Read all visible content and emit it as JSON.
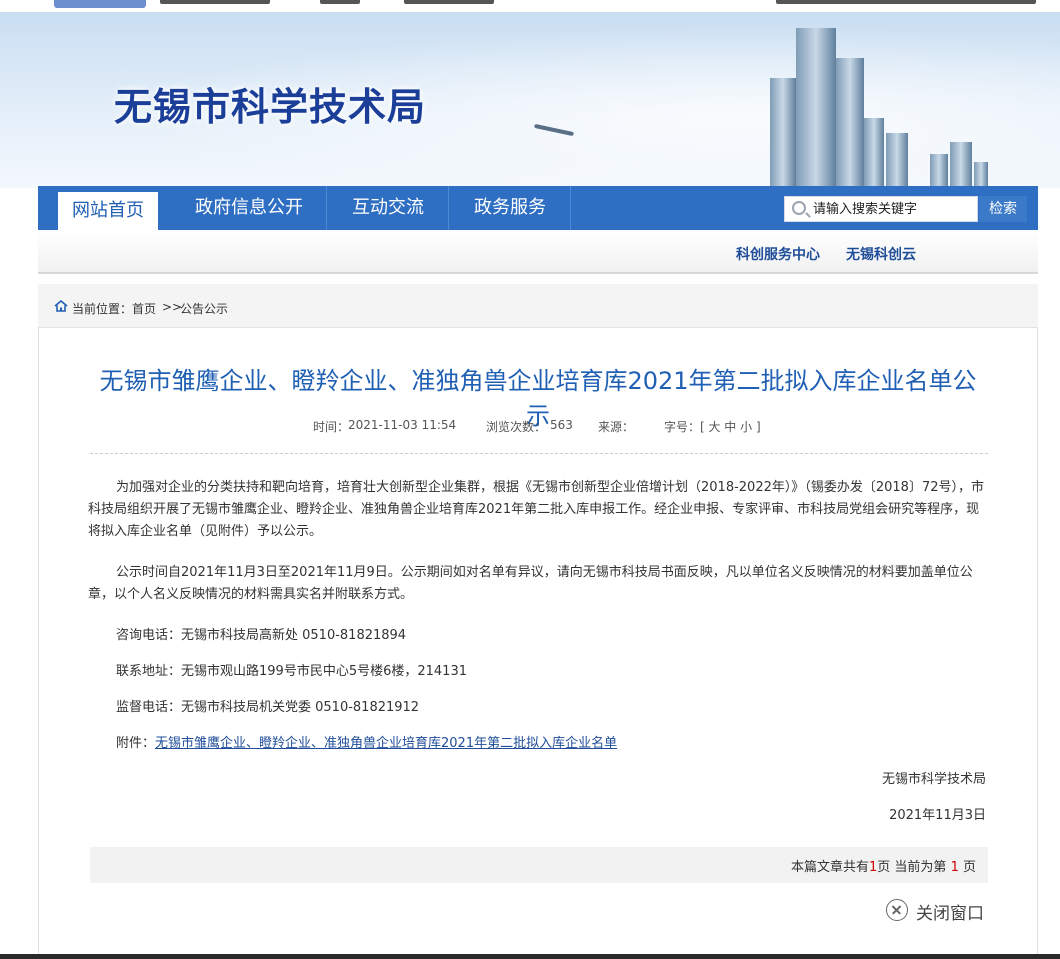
{
  "site": {
    "title": "无锡市科学技术局"
  },
  "nav": {
    "items": [
      {
        "label": "网站首页"
      },
      {
        "label": "政府信息公开"
      },
      {
        "label": "互动交流"
      },
      {
        "label": "政务服务"
      }
    ]
  },
  "search": {
    "placeholder": "请输入搜索关键字",
    "button": "检索"
  },
  "sublinks": [
    {
      "label": "科创服务中心"
    },
    {
      "label": "无锡科创云"
    }
  ],
  "breadcrumb": {
    "prefix": "当前位置：",
    "home": "首页",
    "sep": ">>",
    "current": "公告公示"
  },
  "article": {
    "title": "无锡市雏鹰企业、瞪羚企业、准独角兽企业培育库2021年第二批拟入库企业名单公示",
    "meta": {
      "time_label": "时间：",
      "time": "2021-11-03 11:54",
      "views_label": "浏览次数：",
      "views": "563",
      "source_label": "来源：",
      "fontsize_label": "字号：",
      "fontsize_options": "[ 大 中 小 ]"
    },
    "para1": "为加强对企业的分类扶持和靶向培育，培育壮大创新型企业集群，根据《无锡市创新型企业倍增计划（2018-2022年）》（锡委办发〔2018〕72号），市科技局组织开展了无锡市雏鹰企业、瞪羚企业、准独角兽企业培育库2021年第二批入库申报工作。经企业申报、专家评审、市科技局党组会研究等程序，现将拟入库企业名单（见附件）予以公示。",
    "para2": "公示时间自2021年11月3日至2021年11月9日。公示期间如对名单有异议，请向无锡市科技局书面反映，凡以单位名义反映情况的材料要加盖单位公章，以个人名义反映情况的材料需具实名并附联系方式。",
    "consult": "咨询电话：无锡市科技局高新处 0510-81821894",
    "address": "联系地址：无锡市观山路199号市民中心5号楼6楼，214131",
    "supervise": "监督电话：无锡市科技局机关党委 0510-81821912",
    "attach_label": "附件：",
    "attach_link": "无锡市雏鹰企业、瞪羚企业、准独角兽企业培育库2021年第二批拟入库企业名单",
    "signer": "无锡市科学技术局",
    "date": "2021年11月3日"
  },
  "pager": {
    "prefix": "本篇文章共有",
    "total": "1",
    "middle": "页 当前为第",
    "current": "1",
    "suffix": "页"
  },
  "close": {
    "label": "关闭窗口"
  }
}
